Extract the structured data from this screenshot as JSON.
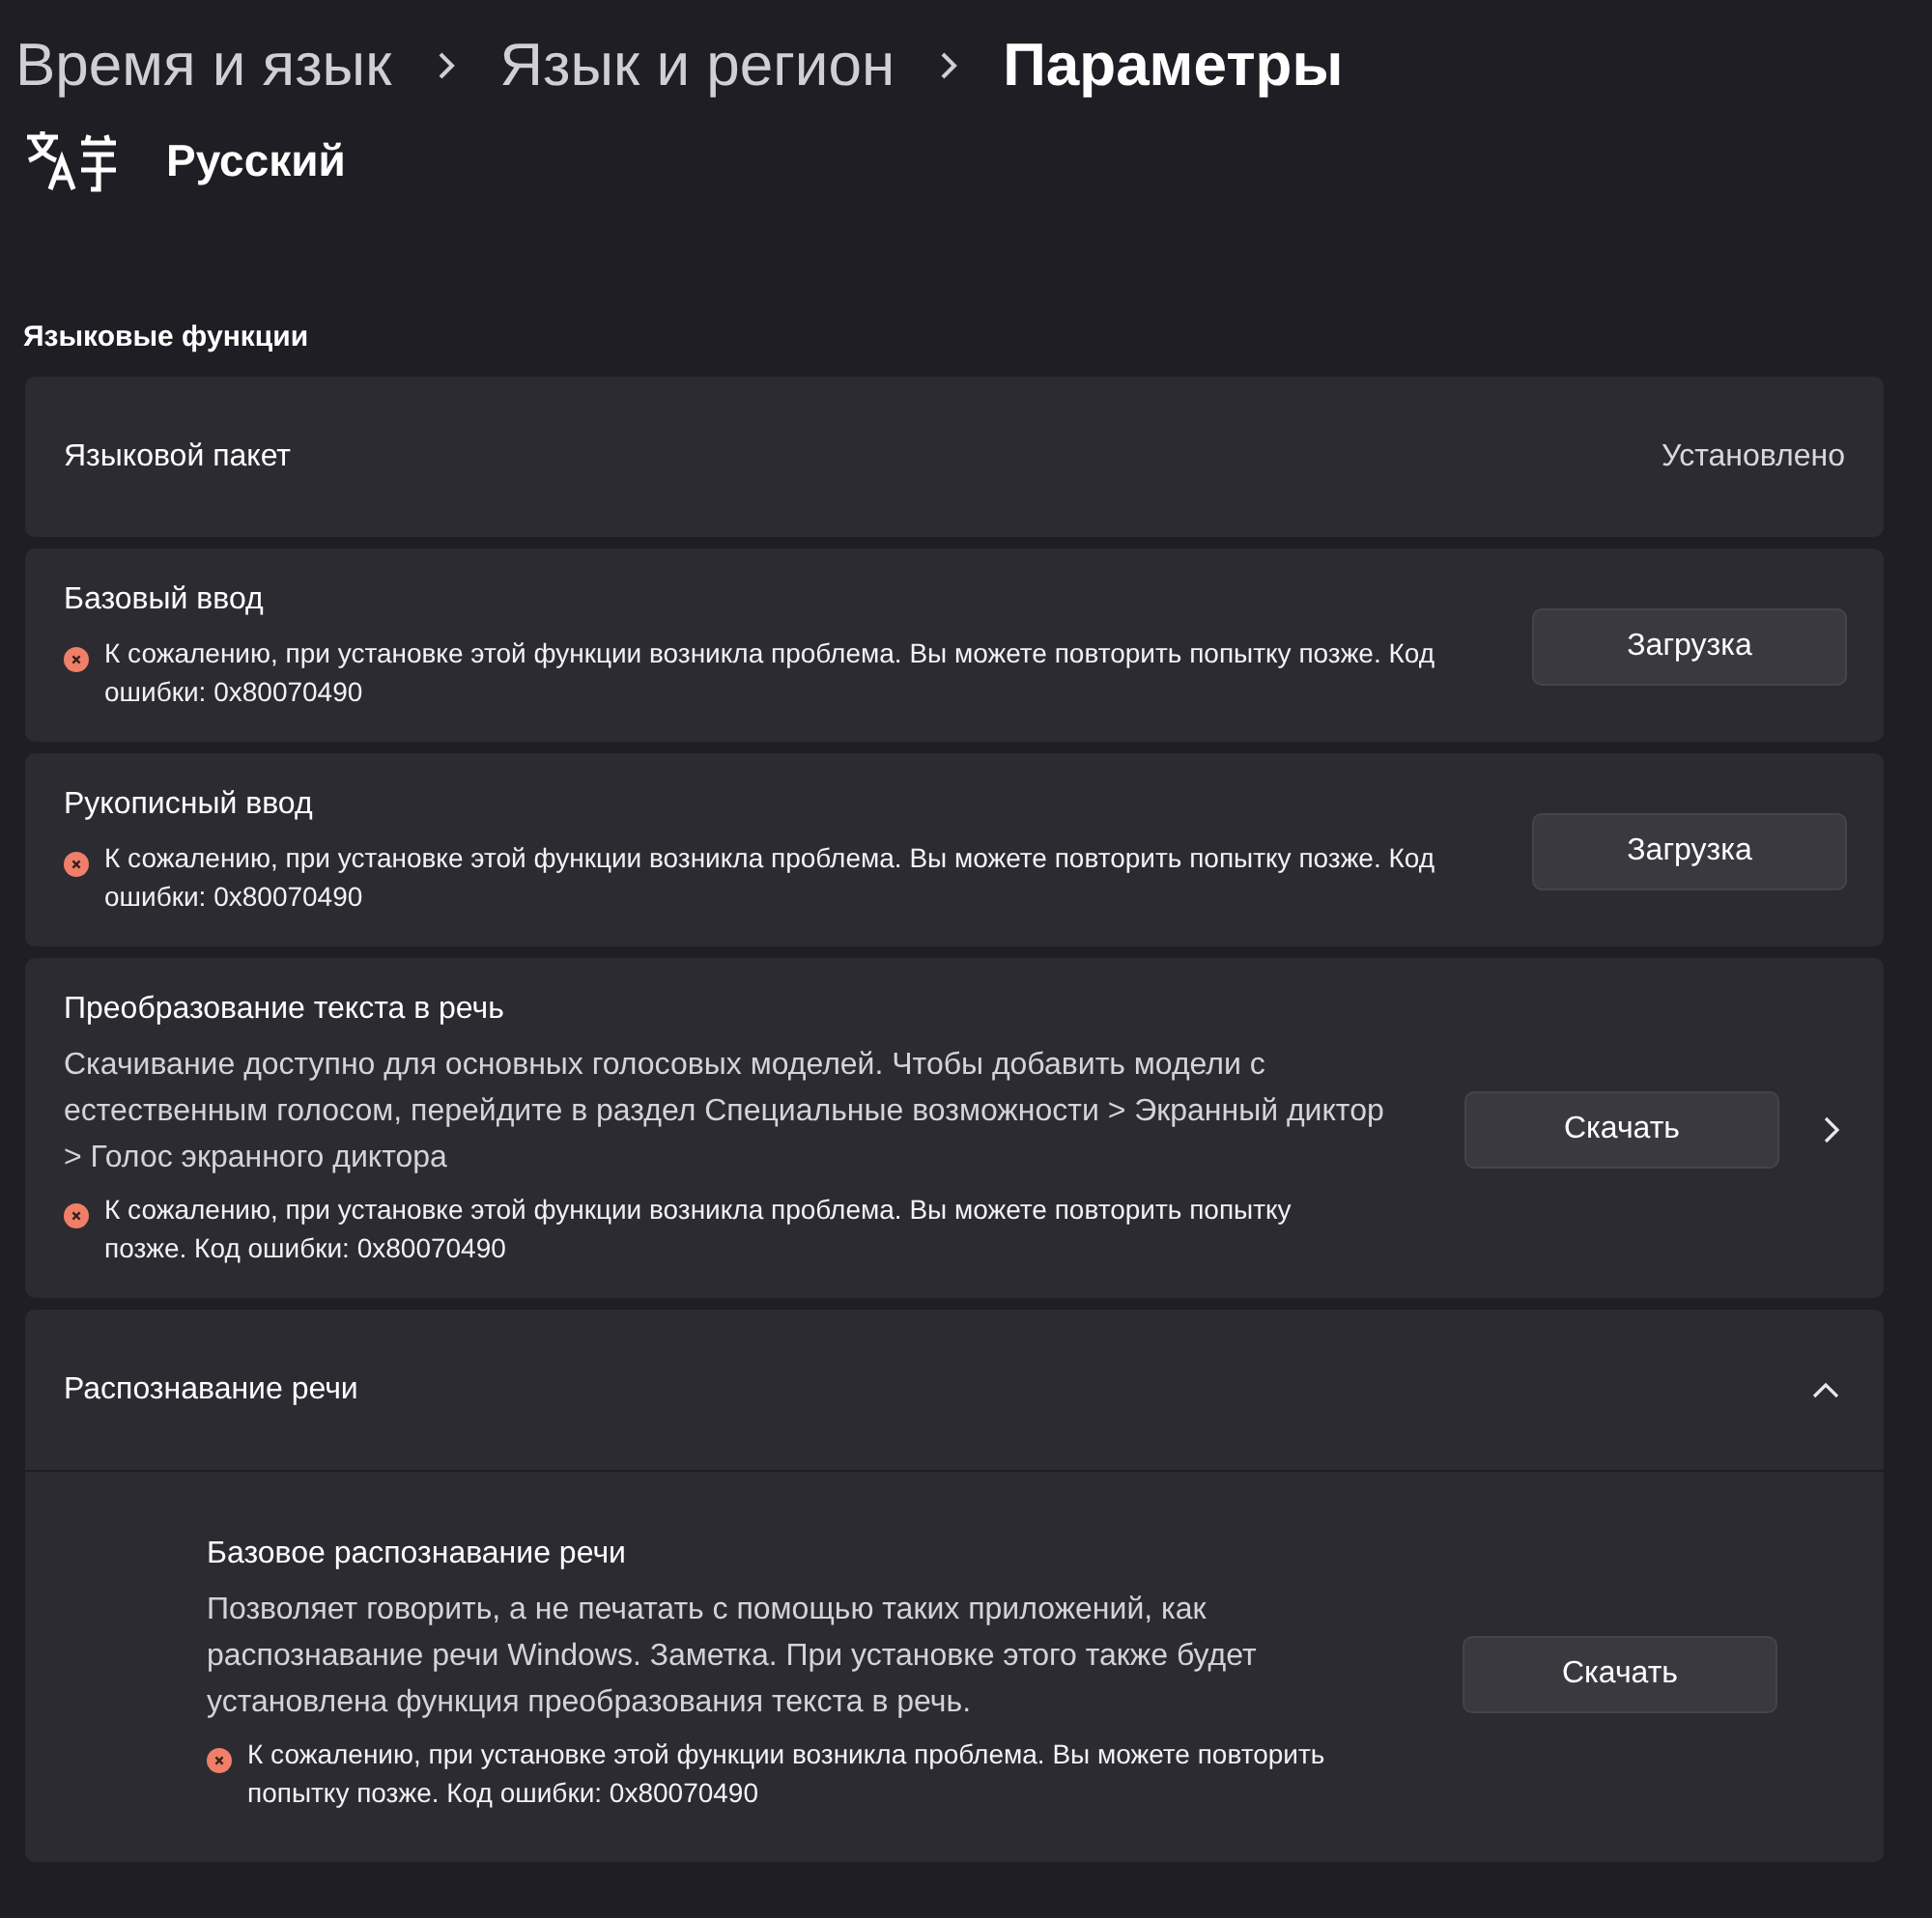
{
  "breadcrumb": [
    {
      "label": "Время и язык",
      "current": false
    },
    {
      "label": "Язык и регион",
      "current": false
    },
    {
      "label": "Параметры",
      "current": true
    }
  ],
  "language": {
    "name": "Русский"
  },
  "section_title": "Языковые функции",
  "features": [
    {
      "kind": "status",
      "title": "Языковой пакет",
      "status": "Установлено"
    },
    {
      "kind": "download",
      "title": "Базовый ввод",
      "error": "К сожалению, при установке этой функции возникла проблема. Вы можете повторить попытку позже. Код ошибки: 0x80070490",
      "button": "Загрузка",
      "chevron": false
    },
    {
      "kind": "download",
      "title": "Рукописный ввод",
      "error": "К сожалению, при установке этой функции возникла проблема. Вы можете повторить попытку позже. Код ошибки: 0x80070490",
      "button": "Загрузка",
      "chevron": false
    },
    {
      "kind": "download",
      "title": "Преобразование текста в речь",
      "description": "Скачивание доступно для основных голосовых моделей. Чтобы добавить модели с естественным голосом, перейдите в раздел Специальные возможности > Экранный диктор > Голос экранного диктора",
      "error": "К сожалению, при установке этой функции возникла проблема. Вы можете повторить попытку позже. Код ошибки: 0x80070490",
      "button": "Скачать",
      "chevron": true
    },
    {
      "kind": "group",
      "title": "Распознавание речи",
      "expanded": true,
      "children": [
        {
          "title": "Базовое распознавание речи",
          "description": "Позволяет говорить, а не печатать с помощью таких приложений, как распознавание речи Windows. Заметка. При установке этого также будет установлена функция преобразования текста в речь.",
          "error": "К сожалению, при установке этой функции возникла проблема. Вы можете повторить попытку позже. Код ошибки: 0x80070490",
          "button": "Скачать"
        }
      ]
    }
  ]
}
